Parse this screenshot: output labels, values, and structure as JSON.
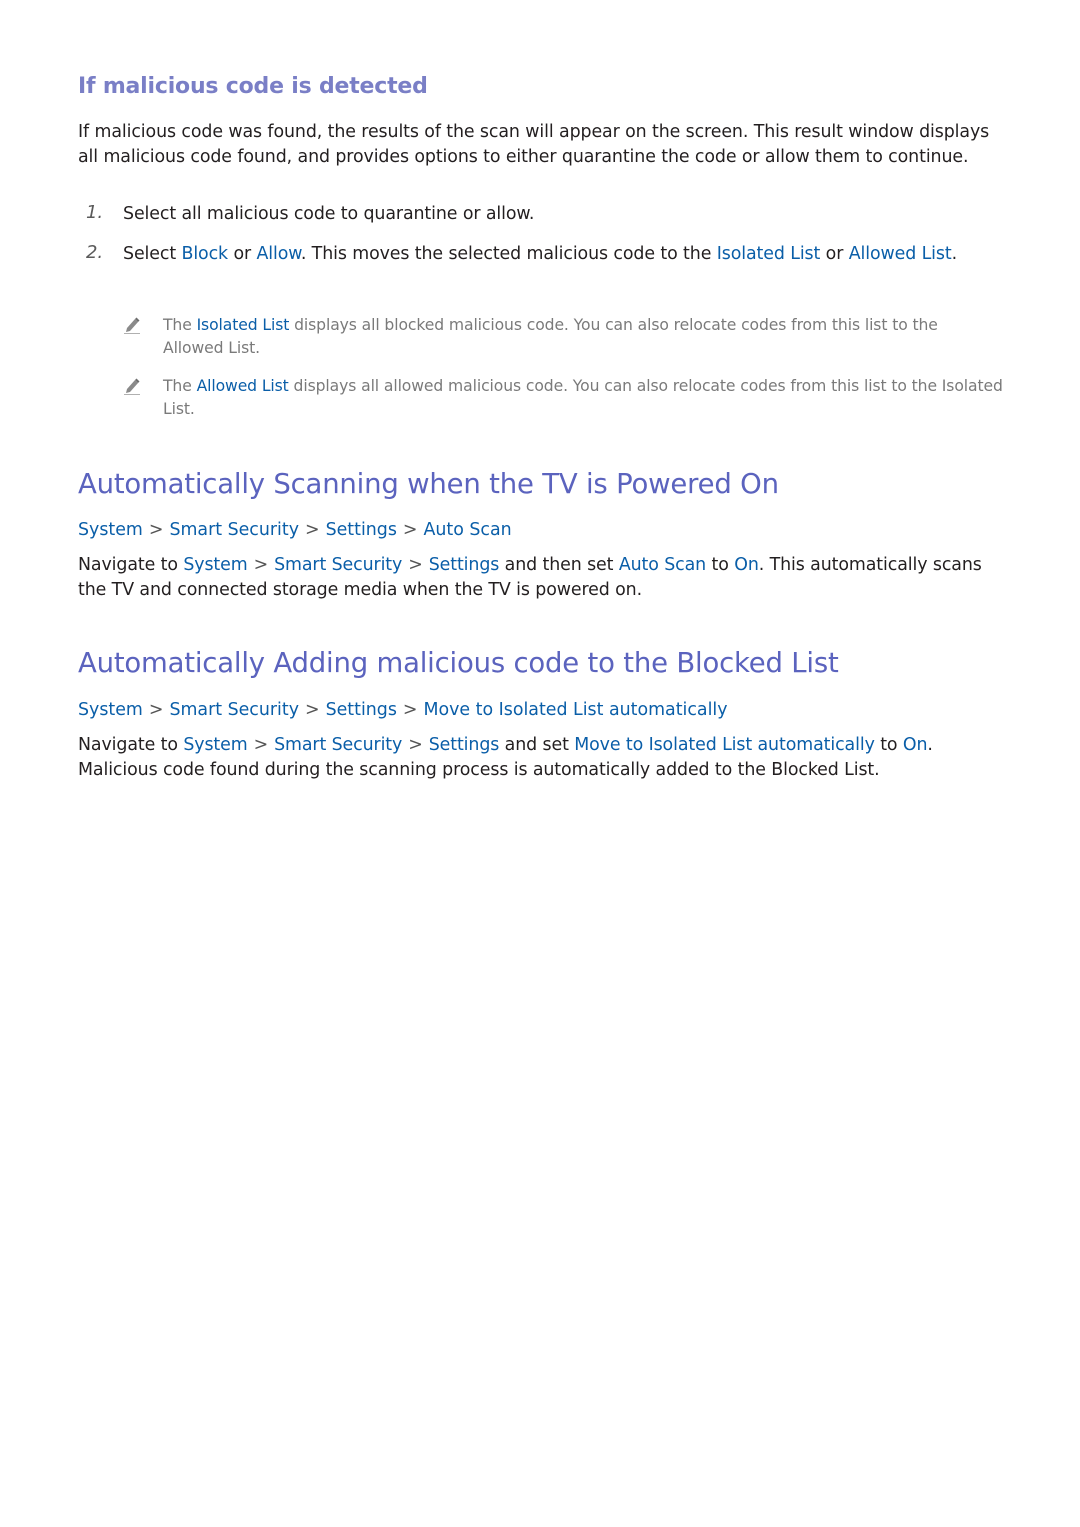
{
  "section_detected": {
    "heading": "If malicious code is detected",
    "intro": "If malicious code was found, the results of the scan will appear on the screen. This result window displays all malicious code found, and provides options to either quarantine the code or allow them to continue.",
    "steps": [
      {
        "number": "1.",
        "text": "Select all malicious code to quarantine or allow."
      },
      {
        "number": "2.",
        "t1": "Select ",
        "block": "Block",
        "t2": " or ",
        "allow": "Allow",
        "t3": ". This moves the selected malicious code to the ",
        "isolated_list": "Isolated List",
        "t4": " or ",
        "allowed_list": "Allowed List",
        "t5": "."
      }
    ],
    "notes": [
      {
        "icon": "pencil-icon",
        "t1": "The ",
        "term": "Isolated List",
        "t2": " displays all blocked malicious code. You can also relocate codes from this list to the Allowed List."
      },
      {
        "icon": "pencil-icon",
        "t1": "The ",
        "term": "Allowed List",
        "t2": " displays all allowed malicious code. You can also relocate codes from this list to the Isolated List."
      }
    ]
  },
  "section_auto_scan": {
    "heading": "Automatically Scanning when the TV is Powered On",
    "breadcrumb": [
      "System",
      "Smart Security",
      "Settings",
      "Auto Scan"
    ],
    "separator": ">",
    "para": {
      "t1": "Navigate to ",
      "path": [
        "System",
        "Smart Security",
        "Settings"
      ],
      "t2": " and then set ",
      "option": "Auto Scan",
      "t3": " to ",
      "value": "On",
      "t4": ". This automatically scans the TV and connected storage media when the TV is powered on."
    }
  },
  "section_auto_add": {
    "heading": "Automatically Adding malicious code to the Blocked List",
    "breadcrumb": [
      "System",
      "Smart Security",
      "Settings",
      "Move to Isolated List automatically"
    ],
    "separator": ">",
    "para": {
      "t1": "Navigate to ",
      "path": [
        "System",
        "Smart Security",
        "Settings"
      ],
      "t2": " and set ",
      "option": "Move to Isolated List automatically",
      "t3": " to ",
      "value": "On",
      "t4": ". Malicious code found during the scanning process is automatically added to the Blocked List."
    }
  },
  "colors": {
    "heading_h2": "#5b63be",
    "heading_h3": "#7a7fc6",
    "link_blue": "#0a5ea8",
    "body_text": "#231f20",
    "note_text": "#7a7a7a"
  }
}
